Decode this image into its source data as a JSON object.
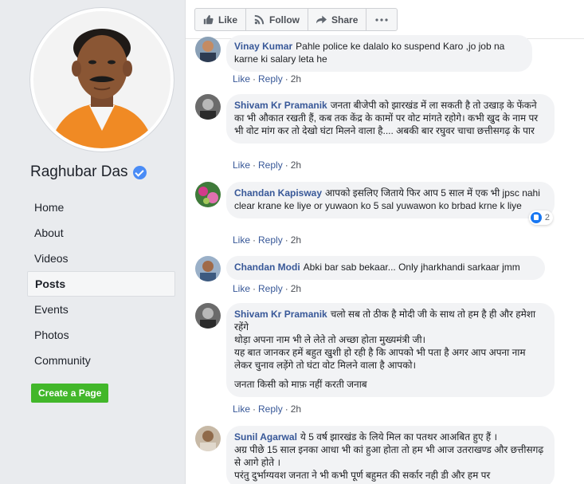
{
  "page": {
    "name": "Raghubar Das",
    "nav": [
      "Home",
      "About",
      "Videos",
      "Posts",
      "Events",
      "Photos",
      "Community"
    ],
    "active_nav": "Posts",
    "create_page_label": "Create a Page"
  },
  "actions": {
    "like": "Like",
    "follow": "Follow",
    "share": "Share"
  },
  "meta": {
    "like": "Like",
    "reply": "Reply",
    "sep": "·"
  },
  "comments": [
    {
      "author": "Vinay Kumar",
      "text": "Pahle police ke dalalo ko suspend Karo ,jo job na karne ki salary leta he",
      "time": "2h"
    },
    {
      "author": "Shivam Kr Pramanik",
      "text": "जनता बीजेपी को झारखंड में ला सकती है तो उखाड़ के फेंकने का भी औकात रखती हैं, कब तक केंद्र के कामों पर वोट मांगते रहोगे। कभी खुद के नाम पर भी वोट मांग कर तो देखो घंटा मिलने वाला है.... अबकी बार रघुवर चाचा छत्तीसगढ़ के पार",
      "time": "2h"
    },
    {
      "author": "Chandan Kapisway",
      "text": "आपको इसलिए जिताये फिर आप 5 साल में एक भी jpsc nahi clear krane ke liye or yuwaon ko 5 sal yuwawon ko brbad krne k liye",
      "time": "2h",
      "reactions": "2"
    },
    {
      "author": "Chandan Modi",
      "text": "Abki bar sab bekaar... Only jharkhandi sarkaar jmm",
      "time": "2h"
    },
    {
      "author": "Shivam Kr Pramanik",
      "text_lines": [
        "चलो सब तो ठीक है मोदी जी के साथ तो हम है ही और हमेशा रहेंगे",
        "थोड़ा अपना नाम भी ले लेते तो अच्छा होता मुख्यमंत्री जी।",
        "यह बात जानकर हमें बहुत खुशी हो रही है कि आपको भी पता है अगर आप अपना नाम लेकर चुनाव लड़ेंगे तो घंटा वोट मिलने वाला है आपको।",
        "जनता किसी को माफ़ नहीं करती जनाब"
      ],
      "time": "2h"
    },
    {
      "author": "Sunil Agarwal",
      "text_lines": [
        "ये 5 वर्ष झारखंड के लिये मिल का पतथर आअबित हुए हैं ।",
        "अग्र पीछे 15 साल इनका आधा भी कां हुआ होता तो हम भी आज उतराखण्ड और छत्तीसगढ़ से आगे होते ।",
        "परंतु दुर्भाग्यवश जनता ने भी कभी पूर्ण बहुमत की सर्कार नही डी और हम पर"
      ]
    }
  ]
}
